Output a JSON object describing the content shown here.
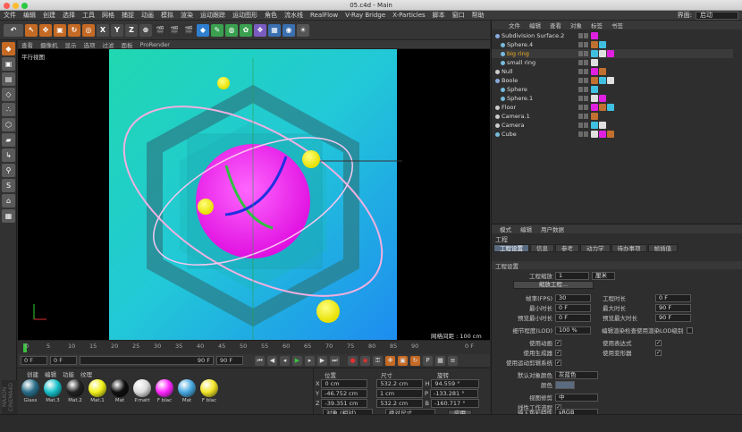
{
  "window": {
    "title": "05.c4d - Main"
  },
  "menu": {
    "items": [
      "文件",
      "编辑",
      "创建",
      "选择",
      "工具",
      "网格",
      "捕捉",
      "动画",
      "模拟",
      "渲染",
      "运动跟踪",
      "运动图形",
      "角色",
      "流水线",
      "RealFlow",
      "V-Ray Bridge",
      "X-Particles",
      "脚本",
      "窗口",
      "帮助"
    ],
    "interface_label": "界面:",
    "interface_value": "启动"
  },
  "toolbar": {
    "axes": [
      "X",
      "Y",
      "Z"
    ]
  },
  "viewport": {
    "menu": [
      "查看",
      "摄像机",
      "显示",
      "选项",
      "过滤",
      "面板",
      "ProRender"
    ],
    "view_name": "平行视图",
    "grid_spacing": "网格间距 : 100 cm"
  },
  "timeline": {
    "ticks": [
      "0",
      "5",
      "10",
      "15",
      "20",
      "25",
      "30",
      "35",
      "40",
      "45",
      "50",
      "55",
      "60",
      "65",
      "70",
      "75",
      "80",
      "85",
      "90"
    ],
    "end_label": "0 F"
  },
  "transport": {
    "current_frame": "0 F",
    "start_frame": "0 F",
    "range_end": "90 F",
    "end_frame": "90 F"
  },
  "materials": {
    "menu": [
      "创建",
      "编辑",
      "功能",
      "纹理"
    ],
    "items": [
      {
        "name": "Glass",
        "color": "#2a6f8a"
      },
      {
        "name": "Mat.3",
        "color": "#18c0c8"
      },
      {
        "name": "Mat.2",
        "color": "#222222"
      },
      {
        "name": "Mat.1",
        "color": "#f2f21a"
      },
      {
        "name": "Mat",
        "color": "#101010"
      },
      {
        "name": "P.matt",
        "color": "#dcdcdc"
      },
      {
        "name": "F blac",
        "color": "#ff28ff"
      },
      {
        "name": "Mat",
        "color": "#48a8e0"
      },
      {
        "name": "F blac",
        "color": "#f4e62a"
      }
    ],
    "brand": "MAXON CINEMA4D"
  },
  "coordinates": {
    "headers": [
      "位置",
      "尺寸",
      "旋转"
    ],
    "rows": [
      {
        "axis": "X",
        "pos": "0 cm",
        "size": "532.2 cm",
        "rot_axis": "H",
        "rot": "94.559 °"
      },
      {
        "axis": "Y",
        "pos": "-46.752 cm",
        "size": "1 cm",
        "rot_axis": "P",
        "rot": "-133.281 °"
      },
      {
        "axis": "Z",
        "pos": "-39.351 cm",
        "size": "532.2 cm",
        "rot_axis": "B",
        "rot": "-160.717 °"
      }
    ],
    "mode": "对象 (相对)",
    "size_mode": "绝对尺寸",
    "apply": "应用"
  },
  "objects": {
    "menu": [
      "文件",
      "编辑",
      "查看",
      "对象",
      "标签",
      "书签"
    ],
    "items": [
      {
        "name": "Subdivision Surface.2",
        "indent": 0,
        "color": "#dddddd",
        "icon": "#8ad"
      },
      {
        "name": "Sphere.4",
        "indent": 1,
        "color": "#dddddd",
        "icon": "#7bd"
      },
      {
        "name": "big ring",
        "indent": 1,
        "color": "#f0b020",
        "icon": "#7bd"
      },
      {
        "name": "small ring",
        "indent": 1,
        "color": "#dddddd",
        "icon": "#7bd"
      },
      {
        "name": "Null",
        "indent": 0,
        "color": "#dddddd",
        "icon": "#ccc"
      },
      {
        "name": "Boole",
        "indent": 0,
        "color": "#dddddd",
        "icon": "#8ad"
      },
      {
        "name": "Sphere",
        "indent": 1,
        "color": "#dddddd",
        "icon": "#7bd"
      },
      {
        "name": "Sphere.1",
        "indent": 1,
        "color": "#dddddd",
        "icon": "#7bd"
      },
      {
        "name": "Floor",
        "indent": 0,
        "color": "#dddddd",
        "icon": "#ccc"
      },
      {
        "name": "Camera.1",
        "indent": 0,
        "color": "#dddddd",
        "icon": "#ccc"
      },
      {
        "name": "Camera",
        "indent": 0,
        "color": "#dddddd",
        "icon": "#ccc"
      },
      {
        "name": "Cube",
        "indent": 0,
        "color": "#dddddd",
        "icon": "#7bd"
      }
    ]
  },
  "attributes": {
    "menu": [
      "模式",
      "编辑",
      "用户数据"
    ],
    "section": "工程",
    "tabs": [
      "工程设置",
      "信息",
      "参考",
      "动力学",
      "待办事项",
      "帧插值"
    ],
    "group_title": "工程设置",
    "project_scale_label": "工程缩放",
    "project_scale_value": "1",
    "project_scale_unit": "厘米",
    "scale_project_btn": "缩放工程...",
    "fps_label": "帧率(FPS)",
    "fps_value": "30",
    "project_time_label": "工程时长",
    "project_time_value": "0 F",
    "min_time_label": "最小时长",
    "min_time_value": "0 F",
    "max_time_label": "最大时长",
    "max_time_value": "90 F",
    "preview_min_label": "预览最小时长",
    "preview_min_value": "0 F",
    "preview_max_label": "预览最大时长",
    "preview_max_value": "90 F",
    "lod_label": "细节程度(LOD)",
    "lod_value": "100 %",
    "lod_render_label": "编辑渲染检查使用渲染LOD级别",
    "use_animation": "使用动画",
    "use_expressions": "使用表达式",
    "use_generators": "使用生成器",
    "use_deformers": "使用变形器",
    "use_motion_system": "使用运动剪辑系统",
    "default_color_label": "默认对象颜色",
    "default_color_value": "灰蓝色",
    "color_label": "颜色",
    "view_clip_label": "视图修剪",
    "view_clip_value": "中",
    "linear_workflow_label": "线性工作流程",
    "input_color_label": "输入色彩特性",
    "input_color_value": "sRGB"
  }
}
